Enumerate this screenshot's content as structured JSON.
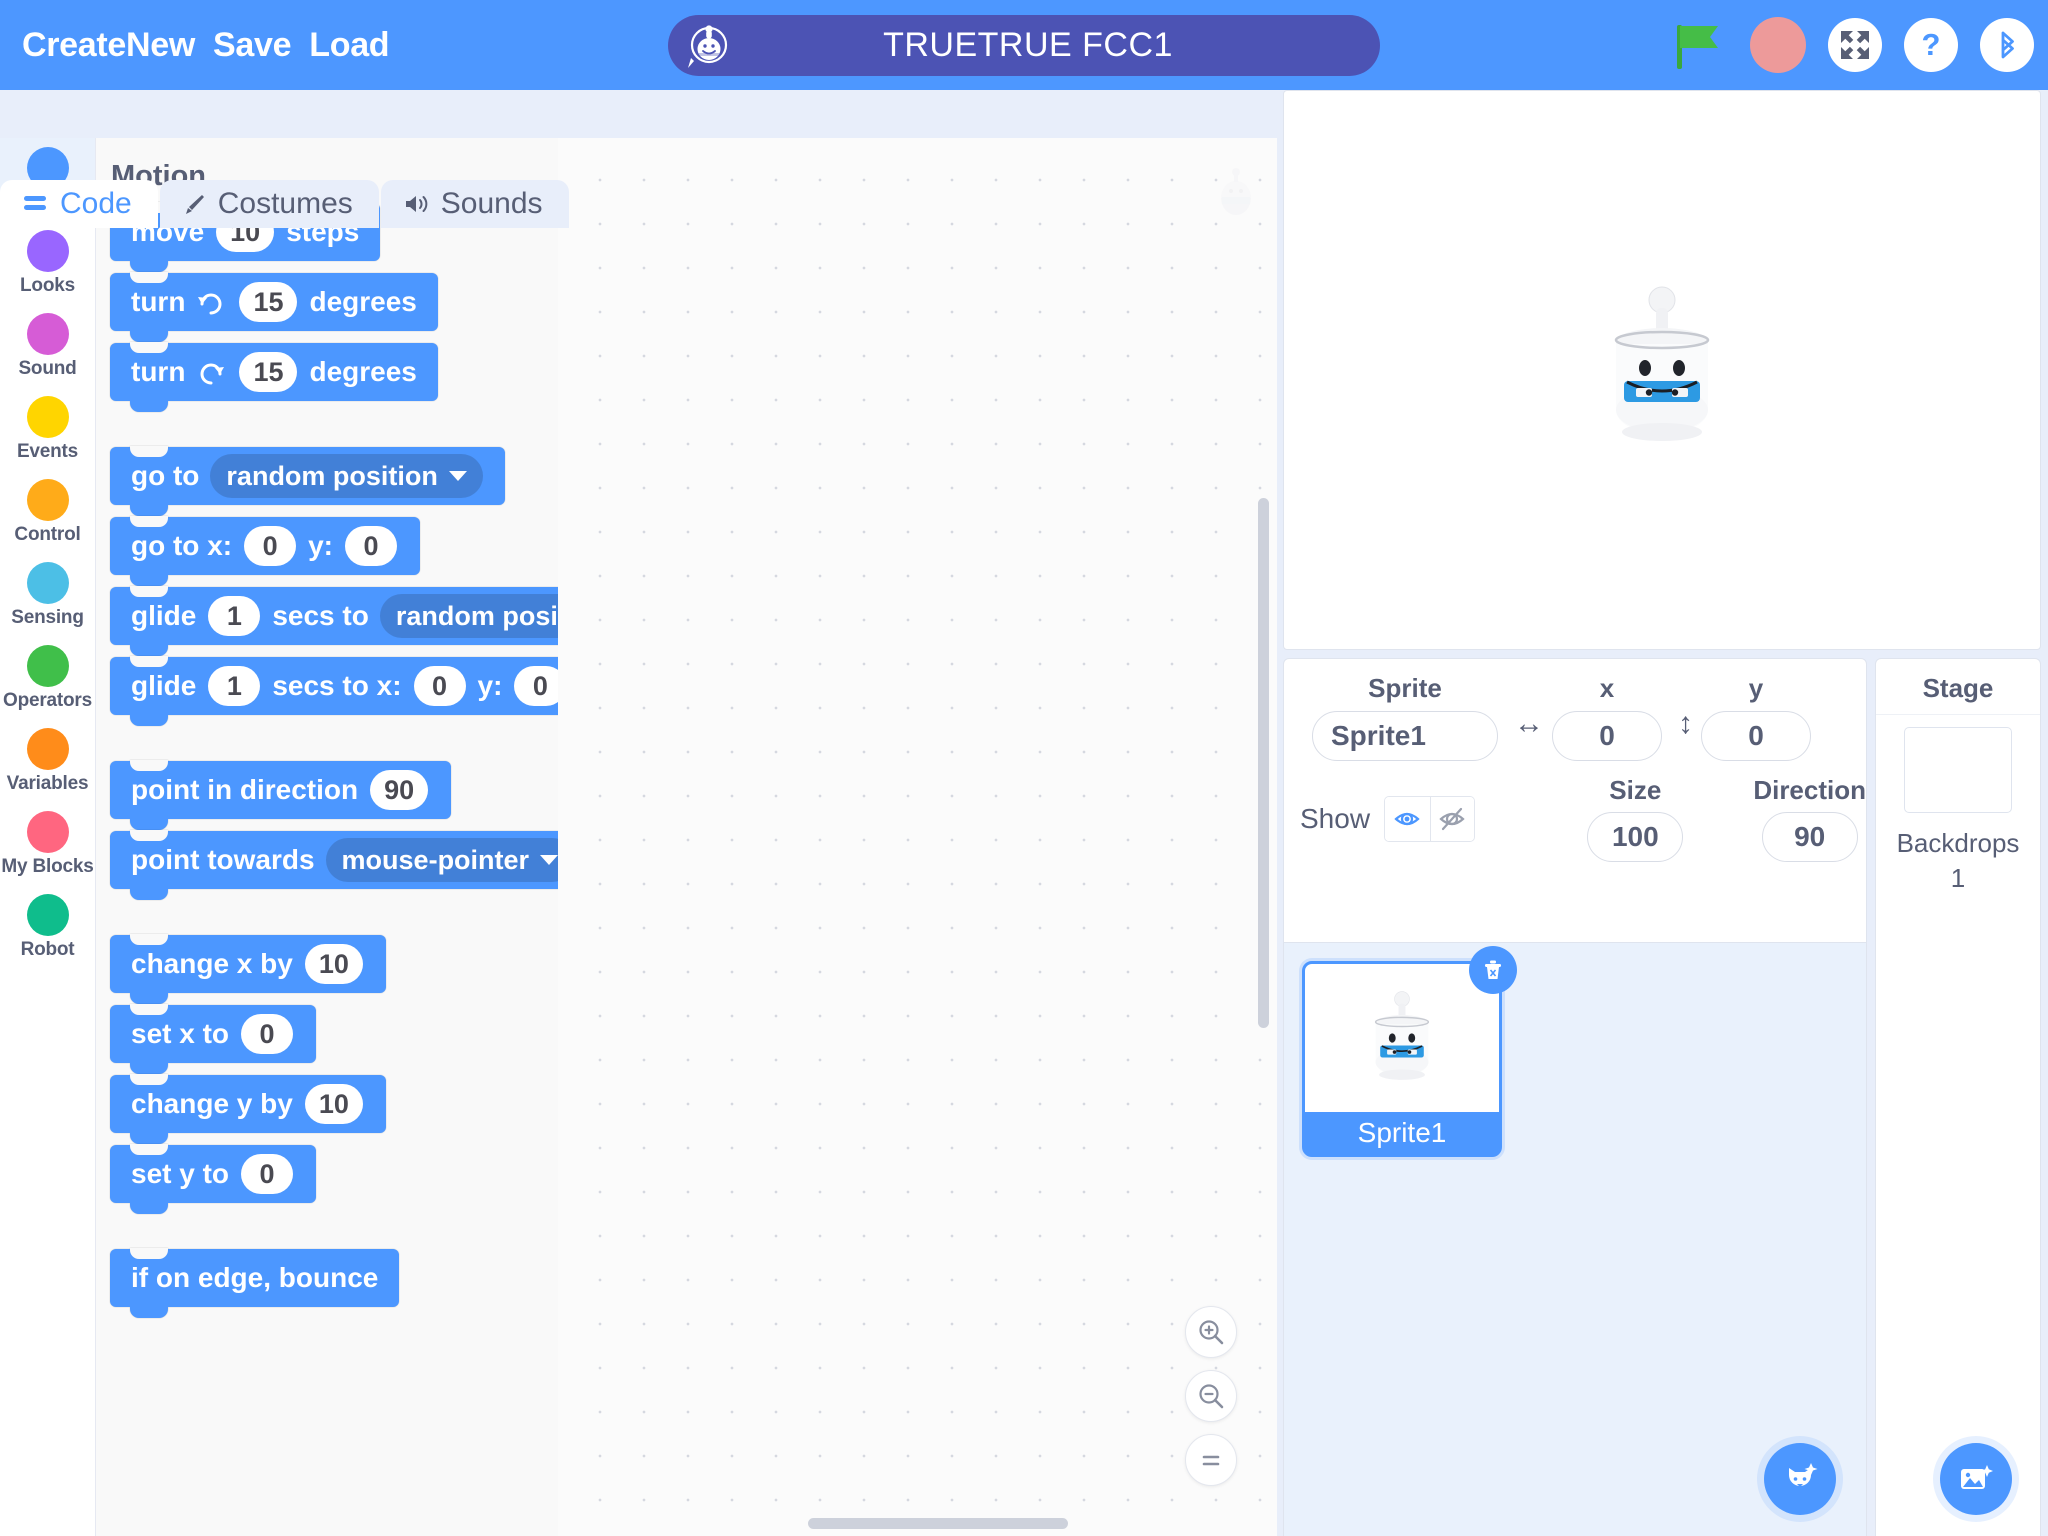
{
  "header": {
    "menu_items": [
      "CreateNew",
      "Save",
      "Load"
    ],
    "project_title": "TRUETRUE FCC1",
    "icons": {
      "logo": "robot-chat-logo",
      "flag": "green-flag-icon",
      "stop": "stop-button-icon",
      "fullscreen": "fullscreen-icon",
      "help": "help-question-icon",
      "bluetooth": "bluetooth-icon"
    },
    "colors": {
      "bar": "#4d97ff",
      "pill": "#4c53b4",
      "flag": "#45bd47",
      "stop": "#ed9a9a"
    }
  },
  "tabs": [
    {
      "label": "Code",
      "icon": "code-blocks-icon",
      "active": true
    },
    {
      "label": "Costumes",
      "icon": "paintbrush-icon",
      "active": false
    },
    {
      "label": "Sounds",
      "icon": "speaker-icon",
      "active": false
    }
  ],
  "categories": [
    {
      "label": "Motion",
      "color": "#4c97ff",
      "selected": true
    },
    {
      "label": "Looks",
      "color": "#9966ff",
      "selected": false
    },
    {
      "label": "Sound",
      "color": "#d65cd6",
      "selected": false
    },
    {
      "label": "Events",
      "color": "#ffd500",
      "selected": false
    },
    {
      "label": "Control",
      "color": "#ffab19",
      "selected": false
    },
    {
      "label": "Sensing",
      "color": "#4cbfe6",
      "selected": false
    },
    {
      "label": "Operators",
      "color": "#40bf4a",
      "selected": false
    },
    {
      "label": "Variables",
      "color": "#ff8c1a",
      "selected": false
    },
    {
      "label": "My Blocks",
      "color": "#ff6680",
      "selected": false
    },
    {
      "label": "Robot",
      "color": "#0fbd8c",
      "selected": false
    }
  ],
  "palette": {
    "header": "Motion",
    "blocks": [
      {
        "id": "move-steps",
        "parts": [
          {
            "t": "text",
            "v": "move"
          },
          {
            "t": "num",
            "v": "10"
          },
          {
            "t": "text",
            "v": "steps"
          }
        ]
      },
      {
        "id": "turn-right",
        "parts": [
          {
            "t": "text",
            "v": "turn"
          },
          {
            "t": "icon",
            "v": "turn-clockwise-icon"
          },
          {
            "t": "num",
            "v": "15"
          },
          {
            "t": "text",
            "v": "degrees"
          }
        ]
      },
      {
        "id": "turn-left",
        "parts": [
          {
            "t": "text",
            "v": "turn"
          },
          {
            "t": "icon",
            "v": "turn-counterclockwise-icon"
          },
          {
            "t": "num",
            "v": "15"
          },
          {
            "t": "text",
            "v": "degrees"
          }
        ]
      },
      {
        "id": "go-to",
        "gapBefore": true,
        "parts": [
          {
            "t": "text",
            "v": "go to"
          },
          {
            "t": "drop",
            "v": "random position"
          }
        ]
      },
      {
        "id": "go-to-xy",
        "parts": [
          {
            "t": "text",
            "v": "go to x:"
          },
          {
            "t": "num",
            "v": "0"
          },
          {
            "t": "text",
            "v": "y:"
          },
          {
            "t": "num",
            "v": "0"
          }
        ]
      },
      {
        "id": "glide-to",
        "parts": [
          {
            "t": "text",
            "v": "glide"
          },
          {
            "t": "num",
            "v": "1"
          },
          {
            "t": "text",
            "v": "secs to"
          },
          {
            "t": "drop",
            "v": "random position"
          }
        ]
      },
      {
        "id": "glide-to-xy",
        "parts": [
          {
            "t": "text",
            "v": "glide"
          },
          {
            "t": "num",
            "v": "1"
          },
          {
            "t": "text",
            "v": "secs to x:"
          },
          {
            "t": "num",
            "v": "0"
          },
          {
            "t": "text",
            "v": "y:"
          },
          {
            "t": "num",
            "v": "0"
          }
        ]
      },
      {
        "id": "point-in-direction",
        "gapBefore": true,
        "parts": [
          {
            "t": "text",
            "v": "point in direction"
          },
          {
            "t": "num",
            "v": "90"
          }
        ]
      },
      {
        "id": "point-towards",
        "parts": [
          {
            "t": "text",
            "v": "point towards"
          },
          {
            "t": "drop",
            "v": "mouse-pointer"
          }
        ]
      },
      {
        "id": "change-x-by",
        "gapBefore": true,
        "parts": [
          {
            "t": "text",
            "v": "change x by"
          },
          {
            "t": "num",
            "v": "10"
          }
        ]
      },
      {
        "id": "set-x-to",
        "parts": [
          {
            "t": "text",
            "v": "set x to"
          },
          {
            "t": "num",
            "v": "0"
          }
        ]
      },
      {
        "id": "change-y-by",
        "parts": [
          {
            "t": "text",
            "v": "change y by"
          },
          {
            "t": "num",
            "v": "10"
          }
        ]
      },
      {
        "id": "set-y-to",
        "parts": [
          {
            "t": "text",
            "v": "set y to"
          },
          {
            "t": "num",
            "v": "0"
          }
        ]
      },
      {
        "id": "if-on-edge-bounce",
        "gapBefore": true,
        "parts": [
          {
            "t": "text",
            "v": "if on edge, bounce"
          }
        ]
      }
    ]
  },
  "workspace": {
    "zoom_controls": [
      {
        "name": "zoom-in-button",
        "icon": "magnifier-plus-icon"
      },
      {
        "name": "zoom-out-button",
        "icon": "magnifier-minus-icon"
      },
      {
        "name": "zoom-reset-button",
        "icon": "equals-icon"
      }
    ]
  },
  "sprite_info": {
    "labels": {
      "sprite": "Sprite",
      "x": "x",
      "y": "y",
      "size": "Size",
      "direction": "Direction",
      "show": "Show"
    },
    "values": {
      "name": "Sprite1",
      "x": "0",
      "y": "0",
      "size": "100",
      "direction": "90"
    },
    "show_visible_selected": true
  },
  "sprite_list": {
    "sprites": [
      {
        "name": "Sprite1",
        "selected": true
      }
    ],
    "add_button": "add-sprite-button"
  },
  "stage_panel": {
    "title": "Stage",
    "backdrops_label": "Backdrops",
    "backdrops_count": "1",
    "add_button": "add-backdrop-button"
  }
}
